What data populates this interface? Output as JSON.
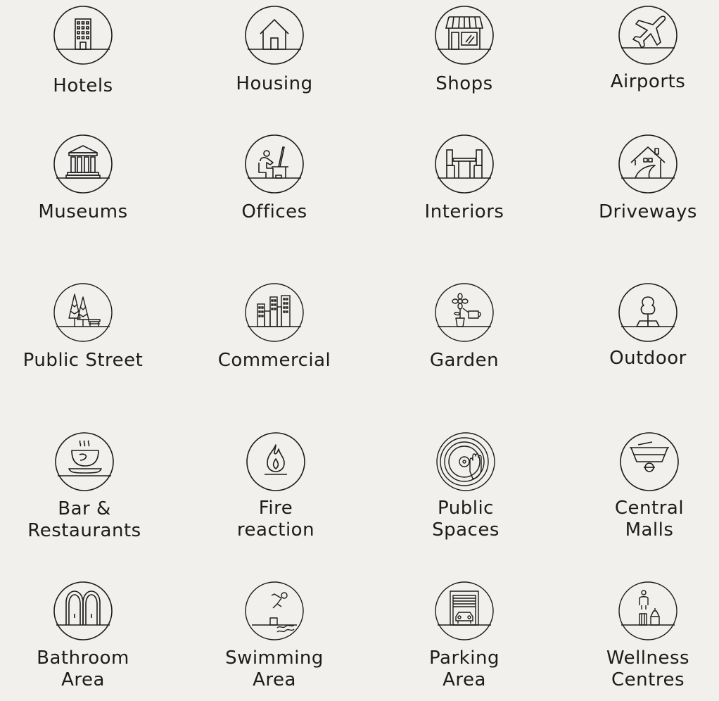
{
  "categories": [
    {
      "label": "Hotels",
      "icon": "hotel-building-icon"
    },
    {
      "label": "Housing",
      "icon": "house-icon"
    },
    {
      "label": "Shops",
      "icon": "shop-storefront-icon"
    },
    {
      "label": "Airports",
      "icon": "airplane-icon"
    },
    {
      "label": "Museums",
      "icon": "museum-icon"
    },
    {
      "label": "Offices",
      "icon": "office-worker-icon"
    },
    {
      "label": "Interiors",
      "icon": "dining-table-icon"
    },
    {
      "label": "Driveways",
      "icon": "driveway-house-icon"
    },
    {
      "label": "Public Street",
      "icon": "park-trees-bench-icon"
    },
    {
      "label": "Commercial",
      "icon": "city-buildings-icon"
    },
    {
      "label": "Garden",
      "icon": "flower-watering-can-icon"
    },
    {
      "label": "Outdoor",
      "icon": "tree-icon"
    },
    {
      "label": "Bar &",
      "label2": "Restaurants",
      "icon": "coffee-cup-icon"
    },
    {
      "label": "Fire",
      "label2": "reaction",
      "icon": "flame-icon"
    },
    {
      "label": "Public",
      "label2": "Spaces",
      "icon": "vinyl-dj-icon"
    },
    {
      "label": "Central",
      "label2": "Malls",
      "icon": "mall-floors-icon"
    },
    {
      "label": "Bathroom",
      "label2": "Area",
      "icon": "bathroom-doors-icon"
    },
    {
      "label": "Swimming",
      "label2": "Area",
      "icon": "swimmer-diving-icon"
    },
    {
      "label": "Parking",
      "label2": "Area",
      "icon": "garage-car-icon"
    },
    {
      "label": "Wellness",
      "label2": "Centres",
      "icon": "wellness-person-icon"
    }
  ],
  "colors": {
    "background": "#f1f0ed",
    "ink": "#1c1c1c"
  }
}
